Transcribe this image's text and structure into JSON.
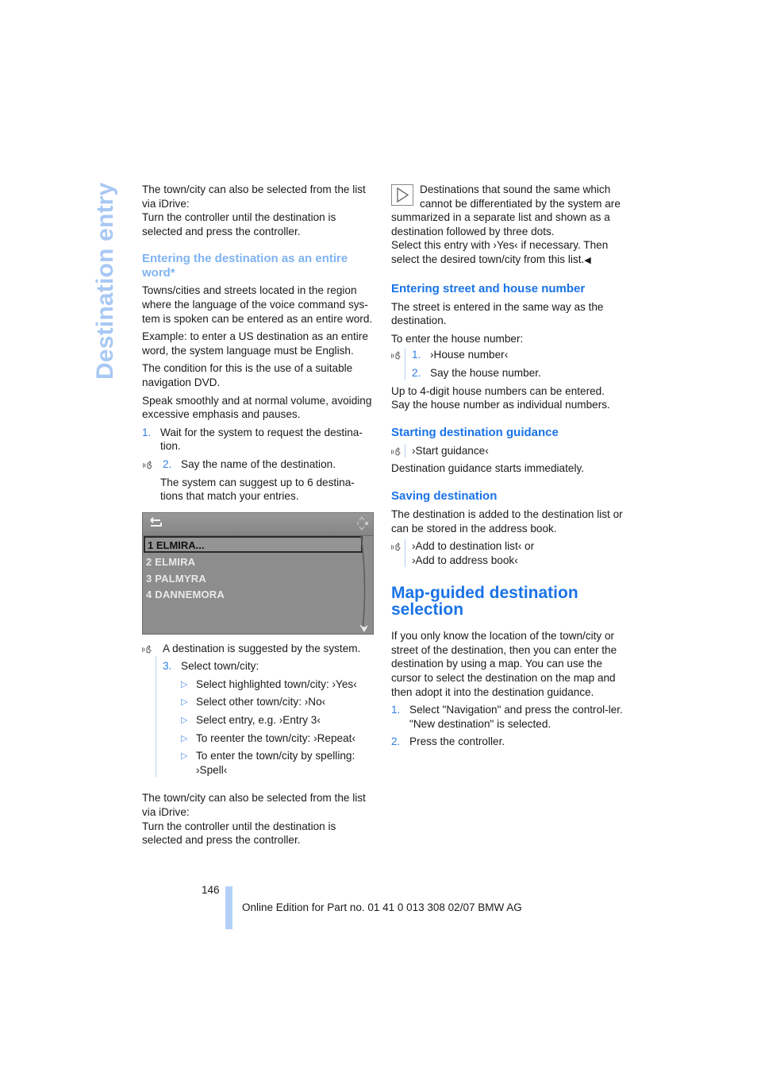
{
  "side_title": "Destination entry",
  "left": {
    "intro": [
      "The town/city can also be selected from the list via iDrive:",
      "Turn the controller until the destination is selected and press the controller."
    ],
    "heading": "Entering the destination as an entire word*",
    "paras": [
      "Towns/cities and streets located in the region where the language of the voice command sys-tem is spoken can be entered as an entire word.",
      "Example: to enter a US destination as an entire word, the system language must be English.",
      "The condition for this is the use of a suitable navigation DVD.",
      "Speak smoothly and at normal volume, avoiding excessive emphasis and pauses."
    ],
    "step1": {
      "num": "1.",
      "text": "Wait for the system to request the destina-tion."
    },
    "step2": {
      "num": "2.",
      "text": "Say the name of the destination."
    },
    "step2_note": "The system can suggest up to 6 destina-tions that match your entries.",
    "screen": {
      "selected": "1 ELMIRA...",
      "items": [
        "2 ELMIRA",
        "3 PALMYRA",
        "4 DANNEMORA"
      ]
    },
    "suggested": "A destination is suggested by the system.",
    "step3": {
      "num": "3.",
      "text": "Select town/city:"
    },
    "options": [
      "Select highlighted town/city: ›Yes‹",
      "Select other town/city: ›No‹",
      "Select entry, e.g. ›Entry 3‹",
      "To reenter the town/city: ›Repeat‹",
      "To enter the town/city by spelling: ›Spell‹"
    ],
    "outro": [
      "The town/city can also be selected from the list via iDrive:",
      "Turn the controller until the destination is selected and press the controller."
    ]
  },
  "right": {
    "note": "Destinations that sound the same which cannot be differentiated by the system are summarized in a separate list and shown as a destination followed by three dots.",
    "note2": "Select this entry with ›Yes‹ if necessary. Then select the desired town/city from this list.",
    "end_mark": "◀",
    "street_heading": "Entering street and house number",
    "street_para": "The street is entered in the same way as the destination.",
    "house_intro": "To enter the house number:",
    "house_steps": [
      {
        "num": "1.",
        "text": "›House number‹"
      },
      {
        "num": "2.",
        "text": "Say the house number."
      }
    ],
    "house_note": "Up to 4-digit house numbers can be entered. Say the house number as individual numbers.",
    "guidance_heading": "Starting destination guidance",
    "guidance_cmd": "›Start guidance‹",
    "guidance_text": "Destination guidance starts immediately.",
    "saving_heading": "Saving destination",
    "saving_text": "The destination is added to the destination list or can be stored in the address book.",
    "saving_cmds": [
      "›Add to destination list‹ or",
      "›Add to address book‹"
    ],
    "map_heading": "Map-guided destination selection",
    "map_text": "If you only know the location of the town/city or street of the destination, then you can enter the destination by using a map. You can use the cursor to select the destination on the map and then adopt it into the destination guidance.",
    "map_steps": [
      {
        "num": "1.",
        "text": "Select \"Navigation\" and press the control-ler.",
        "sub": "\"New destination\" is selected."
      },
      {
        "num": "2.",
        "text": "Press the controller."
      }
    ]
  },
  "footer": {
    "page": "146",
    "edition": "Online Edition for Part no. 01 41 0 013 308 02/07 BMW AG"
  },
  "colors": {
    "accent": "#1a73e8",
    "light_accent": "#80b3f0",
    "side_title": "#a8c8f4",
    "footer_bar": "#b3d1f7"
  }
}
